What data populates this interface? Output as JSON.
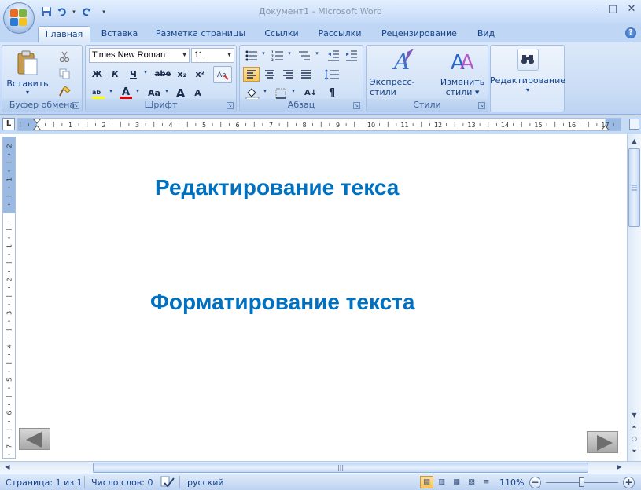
{
  "window": {
    "title": "Документ1 - Microsoft Word",
    "minimize": "–",
    "restore": "□",
    "close": "✕"
  },
  "qat": {
    "save": "💾",
    "undo": "↶",
    "redo": "↺",
    "customize": "▾"
  },
  "tabs": [
    {
      "label": "Главная",
      "active": true
    },
    {
      "label": "Вставка"
    },
    {
      "label": "Разметка страницы"
    },
    {
      "label": "Ссылки"
    },
    {
      "label": "Рассылки"
    },
    {
      "label": "Рецензирование"
    },
    {
      "label": "Вид"
    }
  ],
  "help": "?",
  "ribbon": {
    "clipboard": {
      "label": "Буфер обмена",
      "paste": "Вставить",
      "paste_drop": "▾"
    },
    "font": {
      "label": "Шрифт",
      "font_name": "Times New Roman",
      "font_size": "11",
      "bold": "Ж",
      "italic": "К",
      "underline": "Ч",
      "strike": "abe",
      "subscript": "x₂",
      "superscript": "x²",
      "change_case": "Aa",
      "grow": "A",
      "shrink": "A",
      "font_color": "A"
    },
    "paragraph": {
      "label": "Абзац",
      "sort": "А↓",
      "pilcrow": "¶"
    },
    "styles": {
      "label": "Стили",
      "quick_styles": "Экспресс-стили",
      "change_styles_1": "Изменить",
      "change_styles_2": "стили ▾"
    },
    "editing": {
      "label": "Редактирование",
      "drop": "▾"
    }
  },
  "ruler": {
    "corner": "L"
  },
  "document": {
    "line1": "Редактирование текса",
    "line2": "Форматирование текста"
  },
  "status": {
    "page": "Страница: 1 из 1",
    "words": "Число слов: 0",
    "language": "русский",
    "zoom": "110%",
    "zoom_out": "−",
    "zoom_in": "+"
  },
  "colors": {
    "accent": "#0070c0",
    "ribbon": "#c9dcf5",
    "font_color_bar": "#e00000"
  }
}
